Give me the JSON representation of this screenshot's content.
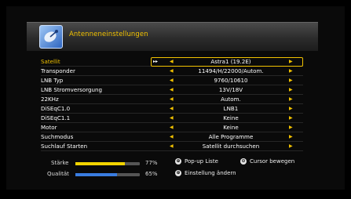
{
  "header": {
    "title": "Antenneneinstellungen"
  },
  "menu": {
    "selected_indicator": "▸▸",
    "rows": [
      {
        "label": "Satellit",
        "value": "Astra1 (19.2E)"
      },
      {
        "label": "Transponder",
        "value": "11494/H/22000/Autom."
      },
      {
        "label": "LNB Typ",
        "value": "9760/10610"
      },
      {
        "label": "LNB Stromversorgung",
        "value": "13V/18V"
      },
      {
        "label": "22KHz",
        "value": "Autom."
      },
      {
        "label": "DiSEqC1.0",
        "value": "LNB1"
      },
      {
        "label": "DiSEqC1.1",
        "value": "Keine"
      },
      {
        "label": "Motor",
        "value": "Keine"
      },
      {
        "label": "Suchmodus",
        "value": "Alle Programme"
      },
      {
        "label": "Suchlauf Starten",
        "value": "Satellit durchsuchen"
      }
    ]
  },
  "signal": {
    "strength_label": "Stärke",
    "strength_pct": "77%",
    "strength_value": 0.77,
    "strength_color": "#f2d400",
    "quality_label": "Qualität",
    "quality_pct": "65%",
    "quality_value": 0.65,
    "quality_color": "#3a7de0"
  },
  "hints": {
    "popup_key": "⊕",
    "popup_label": "Pop-up Liste",
    "cursor_key": "⊙",
    "cursor_label": "Cursor bewegen",
    "change_key": "⊕",
    "change_label": "Einstellung ändern"
  }
}
